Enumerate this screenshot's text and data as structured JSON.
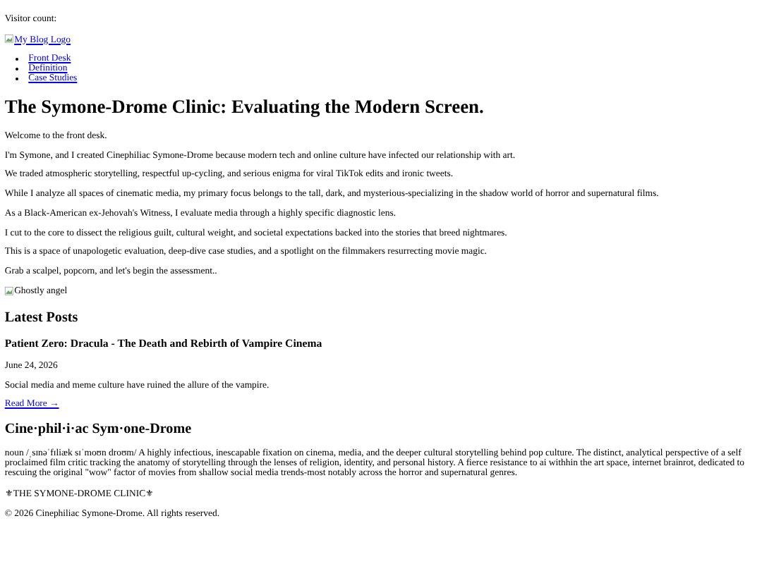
{
  "visitor_count": "Visitor count:",
  "logo": {
    "alt": "My Blog Logo"
  },
  "nav": [
    "Front Desk",
    "Definition",
    "Case Studies"
  ],
  "title": "The Symone-Drome Clinic: Evaluating the Modern Screen.",
  "intro": [
    "Welcome to the front desk.",
    "I'm Symone, and I created Cinephiliac Symone-Drome because modern tech and online culture have infected our relationship with art.",
    "We traded atmospheric storytelling, respectful up-cycling, and serious enigma for viral TikTok edits and ironic tweets.",
    "While I analyze all spaces of cinematic media, my primary focus belongs to the tall, dark, and mysterious-specializing in the shadow world of horror and supernatural films.",
    "As a Black-American ex-Jehovah's Witness, I evaluate media through a highly specific diagnostic lens.",
    "I cut to the core to dissect the religious guilt, cultural weight, and societal expectations backed into the stories that breed nightmares.",
    "This is a space of unapologetic evaluation, deep-dive case studies, and a spotlight on the filmmakers resurrecting movie magic.",
    "Grab a scalpel, popcorn, and let's begin the assessment.."
  ],
  "image": {
    "alt": "Ghostly angel"
  },
  "latest_heading": "Latest Posts",
  "posts": [
    {
      "title": "Patient Zero: Dracula - The Death and Rebirth of Vampire Cinema",
      "date": "June 24, 2026",
      "excerpt": "Social media and meme culture have ruined the allure of the vampire.",
      "link": "Read More →"
    }
  ],
  "definition": {
    "heading": "Cine·phil·i·ac Sym·one-Drome",
    "text": "noun /ˌsɪnəˈfɪliæk sɪˈmoʊn droʊm/ A highly infectious, inescapable fixation on cinema, media, and the deeper cultural storytelling behind pop culture.  The distinct, analytical perspective of a self proclaimed film critic tracking the anatomy of storytelling through the lenses of religion, identity, and personal history. A fierce resistance to ai withhin the art space, internet brainrot, dedicated to rescuing the original \"wow\" factor of movies from shallow social media trends-most notably across the horror and supernatural genres."
  },
  "clinic_label": "⚜THE SYMONE-DROME CLINIC⚜",
  "footer": "© 2026 Cinephiliac Symone-Drome. All rights reserved."
}
